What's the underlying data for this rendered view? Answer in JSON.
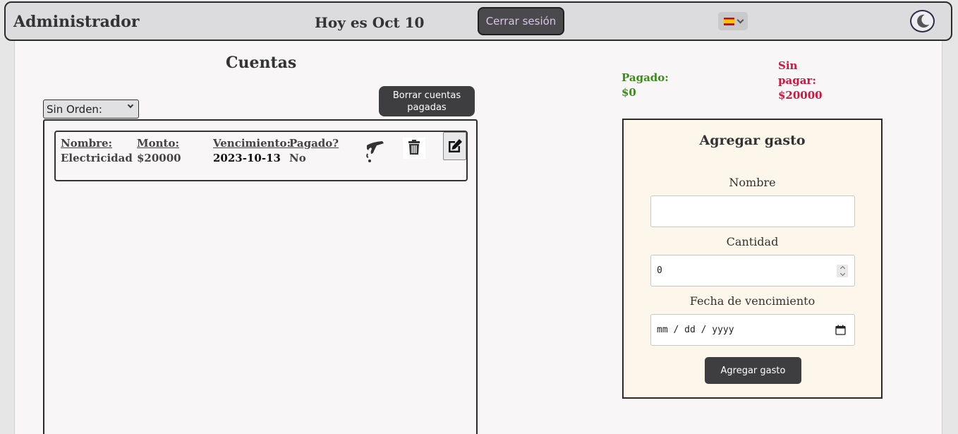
{
  "header": {
    "admin_title": "Administrador",
    "today": "Hoy es Oct 10",
    "logout_label": "Cerrar sesión",
    "language_icon": "spain-flag-icon",
    "theme_icon": "moon-icon"
  },
  "bills": {
    "title": "Cuentas",
    "order_select": "Sin Orden:",
    "delete_paid_label": "Borrar cuentas pagadas",
    "items": [
      {
        "name_header": "Nombre:",
        "name": "Electricidad",
        "amount_header": "Monto:",
        "amount": "$20000",
        "due_header": "Vencimiento:",
        "due": "2023-10-13",
        "paid_header": "Pagado?",
        "paid": "No"
      }
    ]
  },
  "totals": {
    "paid_label": "Pagado:",
    "paid_value": "$0",
    "unpaid_label": "Sin pagar:",
    "unpaid_value": "$20000"
  },
  "form": {
    "title": "Agregar gasto",
    "name_label": "Nombre",
    "name_value": "",
    "amount_label": "Cantidad",
    "amount_value": "0",
    "due_label": "Fecha de vencimiento",
    "due_placeholder": "mm / dd / yyyy",
    "submit_label": "Agregar gasto"
  },
  "colors": {
    "paid": "#3c8c1c",
    "unpaid": "#d2153f",
    "form_bg": "#fdf6ea",
    "button_dark": "#3e3e40"
  }
}
